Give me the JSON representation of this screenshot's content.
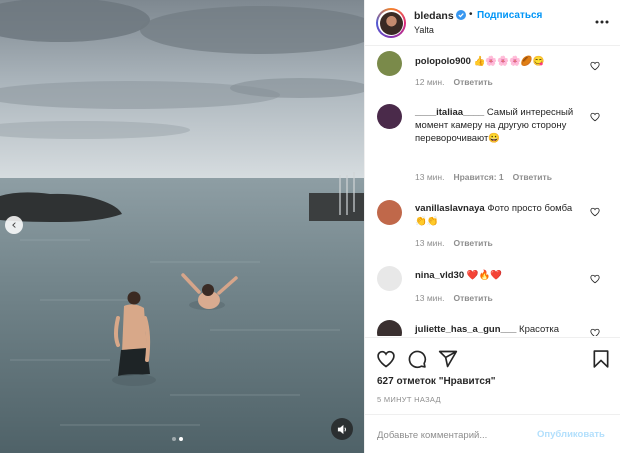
{
  "header": {
    "username": "bledans",
    "separator": "•",
    "follow_label": "Подписаться",
    "location": "Yalta",
    "more_icon": "ellipsis-icon"
  },
  "media": {
    "prev_icon": "‹",
    "slide_count": 2,
    "active_slide": 2,
    "sound_icon": "speaker-icon"
  },
  "comments": [
    {
      "user": "polopolo900",
      "text": "👍🌸🌸🌸🏉😋",
      "time": "12 мин.",
      "likes": "",
      "reply": "Ответить",
      "avatar_color": "#7a8a4a"
    },
    {
      "user": "____italiaa____",
      "text": "Самый интересный момент камеру на другую сторону переворочивают😀",
      "time": "13 мин.",
      "likes": "Нравится: 1",
      "reply": "Ответить",
      "avatar_color": "#4a2a4a"
    },
    {
      "user": "vanillaslavnaya",
      "text": "Фото просто бомба👏👏",
      "time": "13 мин.",
      "likes": "",
      "reply": "Ответить",
      "avatar_color": "#c0684a"
    },
    {
      "user": "nina_vld30",
      "text": "❤️🔥❤️",
      "time": "13 мин.",
      "likes": "",
      "reply": "Ответить",
      "avatar_color": "#e8e8e8"
    },
    {
      "user": "juliette_has_a_gun___",
      "text": "Красотка",
      "time": "",
      "likes": "",
      "reply": "",
      "avatar_color": "#3a3030"
    }
  ],
  "actions": {
    "like_icon": "heart-icon",
    "comment_icon": "comment-icon",
    "share_icon": "share-icon",
    "save_icon": "bookmark-icon",
    "likes_text": "627 отметок \"Нравится\"",
    "time_ago": "5 МИНУТ НАЗАД"
  },
  "add_comment": {
    "placeholder": "Добавьте комментарий...",
    "publish_label": "Опубликовать"
  },
  "colors": {
    "accent": "#0095f6",
    "publish_disabled": "#b2dffc",
    "meta_gray": "#8e8e8e",
    "text": "#262626"
  }
}
